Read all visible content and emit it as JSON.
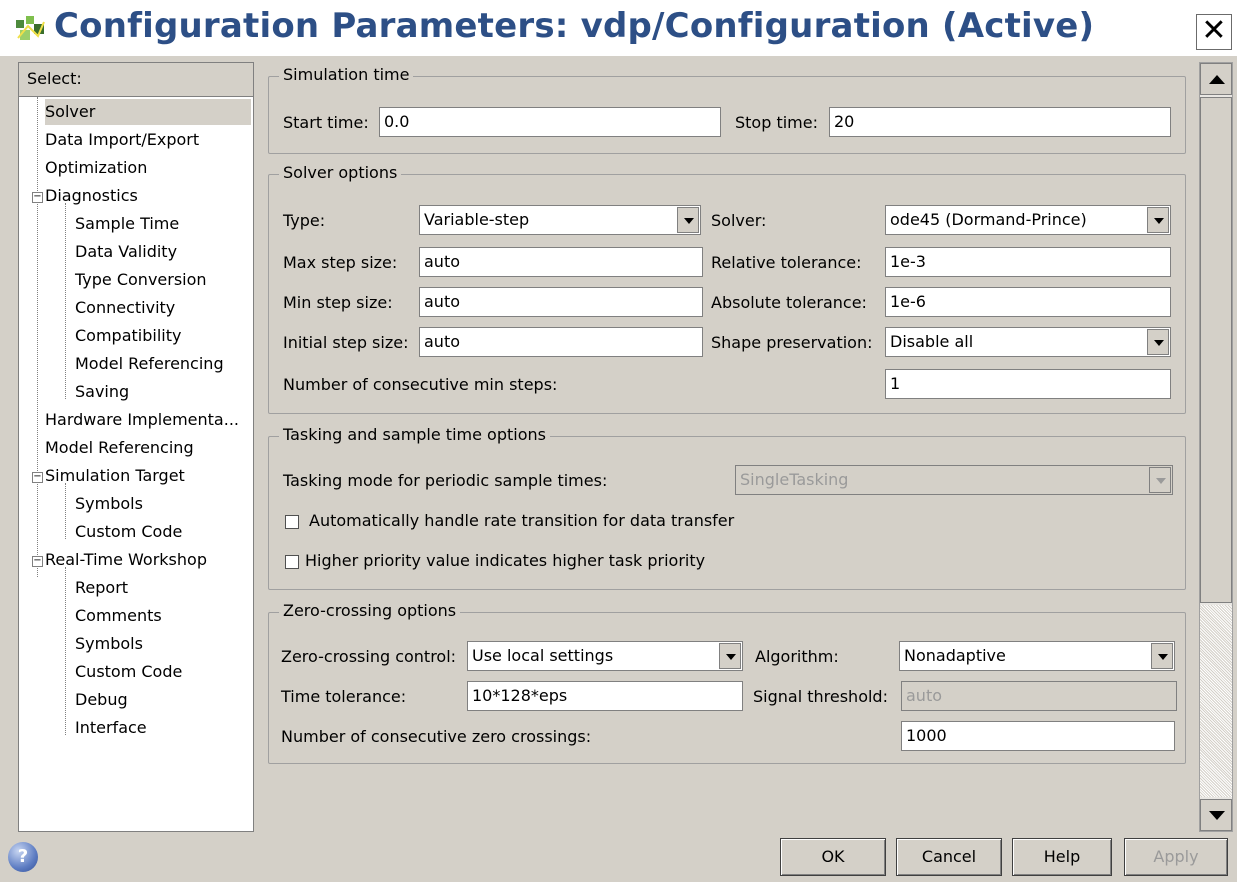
{
  "window": {
    "title": "Configuration Parameters: vdp/Configuration (Active)",
    "close_glyph": "✕"
  },
  "tree": {
    "header": "Select:",
    "items": [
      {
        "label": "Solver"
      },
      {
        "label": "Data Import/Export"
      },
      {
        "label": "Optimization"
      },
      {
        "label": "Diagnostics"
      },
      {
        "label": "Sample Time"
      },
      {
        "label": "Data Validity"
      },
      {
        "label": "Type Conversion"
      },
      {
        "label": "Connectivity"
      },
      {
        "label": "Compatibility"
      },
      {
        "label": "Model Referencing"
      },
      {
        "label": "Saving"
      },
      {
        "label": "Hardware Implementa..."
      },
      {
        "label": "Model Referencing"
      },
      {
        "label": "Simulation Target"
      },
      {
        "label": "Symbols"
      },
      {
        "label": "Custom Code"
      },
      {
        "label": "Real-Time Workshop"
      },
      {
        "label": "Report"
      },
      {
        "label": "Comments"
      },
      {
        "label": "Symbols"
      },
      {
        "label": "Custom Code"
      },
      {
        "label": "Debug"
      },
      {
        "label": "Interface"
      }
    ],
    "toggle_glyph": "−"
  },
  "simulation_time": {
    "title": "Simulation time",
    "start_label": "Start time:",
    "start_value": "0.0",
    "stop_label": "Stop time:",
    "stop_value": "20"
  },
  "solver_options": {
    "title": "Solver options",
    "type_label": "Type:",
    "type_value": "Variable-step",
    "solver_label": "Solver:",
    "solver_value": "ode45 (Dormand-Prince)",
    "max_step_label": "Max step size:",
    "max_step_value": "auto",
    "rel_tol_label": "Relative tolerance:",
    "rel_tol_value": "1e-3",
    "min_step_label": "Min step size:",
    "min_step_value": "auto",
    "abs_tol_label": "Absolute tolerance:",
    "abs_tol_value": "1e-6",
    "init_step_label": "Initial step size:",
    "init_step_value": "auto",
    "shape_label": "Shape preservation:",
    "shape_value": "Disable all",
    "consec_min_label": "Number of consecutive min steps:",
    "consec_min_value": "1"
  },
  "tasking": {
    "title": "Tasking and sample time options",
    "mode_label": "Tasking mode for periodic sample times:",
    "mode_value": "SingleTasking",
    "auto_rate_label": "Automatically handle rate transition for data transfer",
    "auto_rate_checked": false,
    "priority_label": "Higher priority value indicates higher task priority",
    "priority_checked": false
  },
  "zero_crossing": {
    "title": "Zero-crossing options",
    "control_label": "Zero-crossing control:",
    "control_value": "Use local settings",
    "algorithm_label": "Algorithm:",
    "algorithm_value": "Nonadaptive",
    "time_tol_label": "Time tolerance:",
    "time_tol_value": "10*128*eps",
    "signal_label": "Signal threshold:",
    "signal_value": "auto",
    "consec_zero_label": "Number of consecutive zero crossings:",
    "consec_zero_value": "1000"
  },
  "buttons": {
    "ok": "OK",
    "cancel": "Cancel",
    "help": "Help",
    "apply": "Apply"
  },
  "help_icon_glyph": "?",
  "colors": {
    "title": "#2d4f86",
    "dialog_bg": "#d4d0c8",
    "disabled_text": "#9a9a9a"
  }
}
